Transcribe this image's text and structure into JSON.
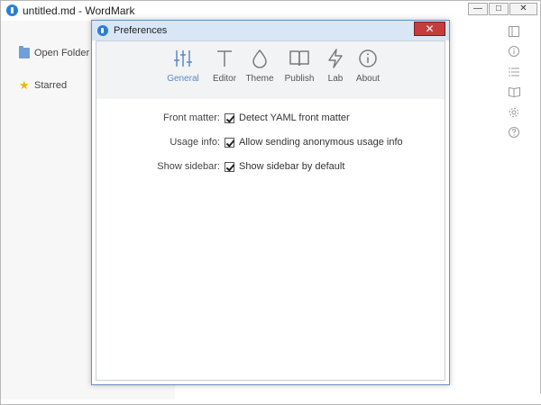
{
  "window": {
    "title": "untitled.md - WordMark",
    "controls": {
      "minimize": "—",
      "maximize": "□",
      "close": "✕"
    }
  },
  "sidebar": {
    "items": [
      {
        "label": "Open Folder",
        "icon": "folder-icon"
      },
      {
        "label": "Starred",
        "icon": "star-icon"
      }
    ]
  },
  "right_toolbar": {
    "icons": [
      "sidebar-panel-icon",
      "info-icon",
      "list-icon",
      "book-icon",
      "settings-icon",
      "help-icon"
    ]
  },
  "dialog": {
    "title": "Preferences",
    "close": "✕",
    "tabs": [
      {
        "label": "General",
        "icon": "sliders-icon",
        "active": true
      },
      {
        "label": "Editor",
        "icon": "text-icon",
        "active": false
      },
      {
        "label": "Theme",
        "icon": "drop-icon",
        "active": false
      },
      {
        "label": "Publish",
        "icon": "book-open-icon",
        "active": false
      },
      {
        "label": "Lab",
        "icon": "lightning-icon",
        "active": false
      },
      {
        "label": "About",
        "icon": "info-circle-icon",
        "active": false
      }
    ],
    "settings": [
      {
        "label": "Front matter:",
        "option": "Detect YAML front matter",
        "checked": true
      },
      {
        "label": "Usage info:",
        "option": "Allow sending anonymous usage info",
        "checked": true
      },
      {
        "label": "Show sidebar:",
        "option": "Show sidebar by default",
        "checked": true
      }
    ]
  },
  "colors": {
    "accent": "#5c88c5",
    "app_icon": "#2b7ed6",
    "close_red": "#c43c3c",
    "dialog_title_bg": "#d8e6f5",
    "tabbar_bg": "#f2f3f5"
  }
}
